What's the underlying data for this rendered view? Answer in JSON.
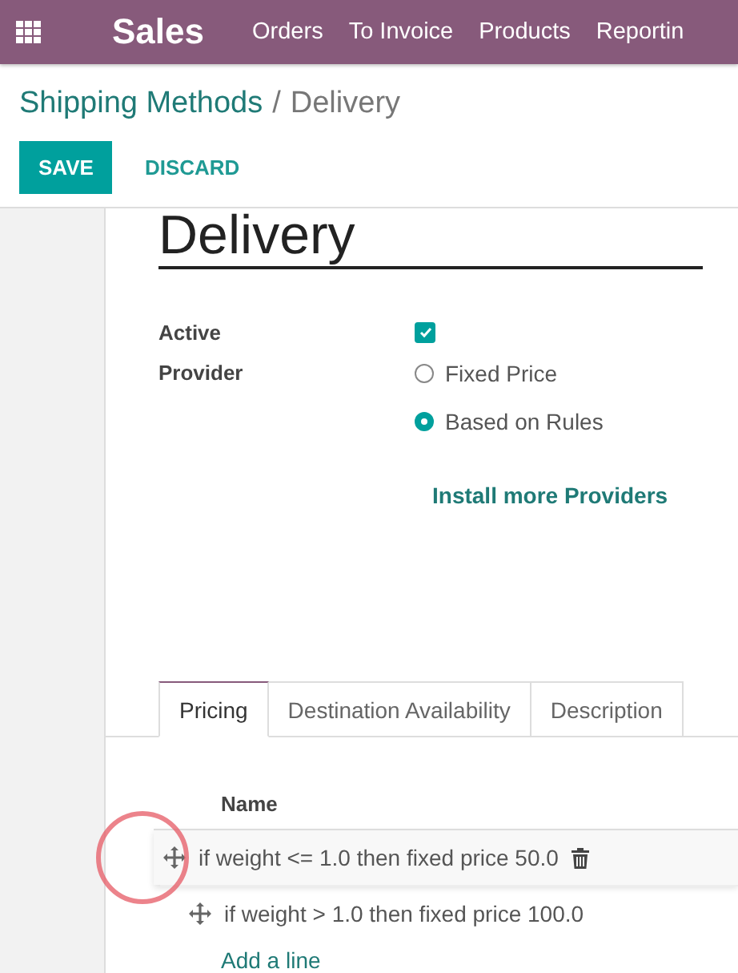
{
  "navbar": {
    "app": "Sales",
    "menu": [
      "Orders",
      "To Invoice",
      "Products",
      "Reportin"
    ]
  },
  "breadcrumb": {
    "parent": "Shipping Methods",
    "separator": "/",
    "current": "Delivery"
  },
  "buttons": [
    {
      "label": "SAVE",
      "kind": "primary"
    },
    {
      "label": "DISCARD",
      "kind": "link"
    }
  ],
  "form": {
    "title": "Delivery",
    "active": {
      "label": "Active",
      "checked": true
    },
    "provider": {
      "label": "Provider",
      "options": [
        {
          "label": "Fixed Price",
          "selected": false
        },
        {
          "label": "Based on Rules",
          "selected": true
        }
      ]
    },
    "install_link": "Install more Providers"
  },
  "tabs": [
    {
      "label": "Pricing",
      "selected": true
    },
    {
      "label": "Destination Availability",
      "selected": false
    },
    {
      "label": "Description",
      "selected": false
    }
  ],
  "rules": {
    "column": "Name",
    "rows": [
      {
        "name": "if weight <= 1.0 then fixed price 50.0",
        "dragging": true
      },
      {
        "name": "if weight > 1.0 then fixed price 100.0",
        "dragging": false
      }
    ],
    "add_line": "Add a line"
  }
}
